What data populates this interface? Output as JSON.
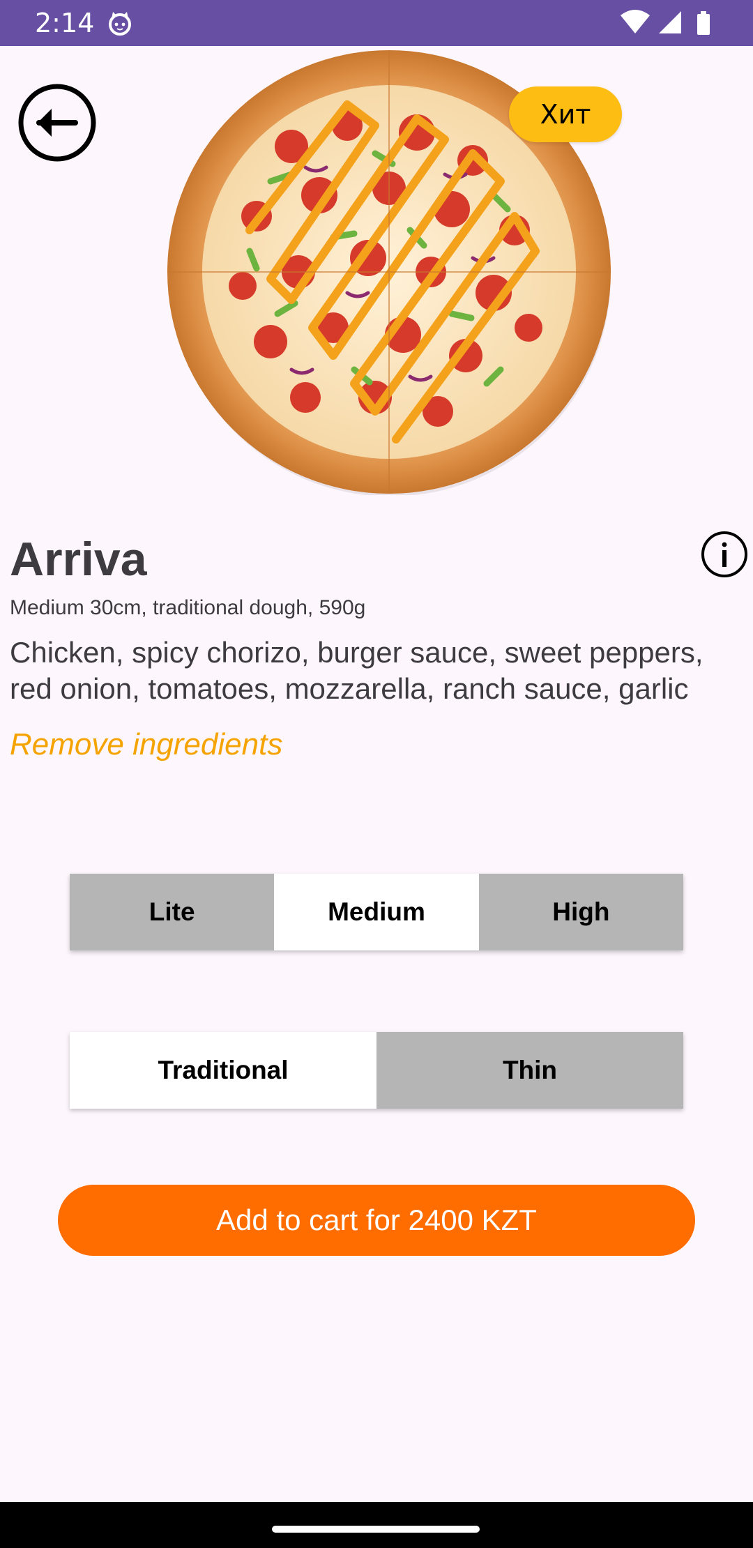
{
  "status_bar": {
    "time": "2:14",
    "background": "#6750a4",
    "icons": [
      "cat-notification-icon",
      "wifi-icon",
      "signal-icon",
      "battery-icon"
    ]
  },
  "product": {
    "badge": "Хит",
    "title": "Arriva",
    "subtitle": "Medium 30cm, traditional dough, 590g",
    "ingredients": "Chicken, spicy chorizo, burger sauce, sweet peppers, red onion, tomatoes, mozzarella, ranch sauce, garlic",
    "remove_ingredients_label": "Remove ingredients"
  },
  "size_options": {
    "selected": "Medium",
    "items": [
      {
        "label": "Lite"
      },
      {
        "label": "Medium"
      },
      {
        "label": "High"
      }
    ]
  },
  "dough_options": {
    "selected": "Traditional",
    "items": [
      {
        "label": "Traditional"
      },
      {
        "label": "Thin"
      }
    ]
  },
  "cart": {
    "button_label": "Add to cart for 2400 KZT"
  },
  "colors": {
    "accent": "#ff6c00",
    "link": "#f5a300",
    "badge": "#fdbd12",
    "unselected_segment": "#b5b5b5",
    "background": "#fdf7fd"
  },
  "icons": {
    "back": "back-arrow-icon",
    "info": "info-icon",
    "product_image": "pizza-image"
  }
}
